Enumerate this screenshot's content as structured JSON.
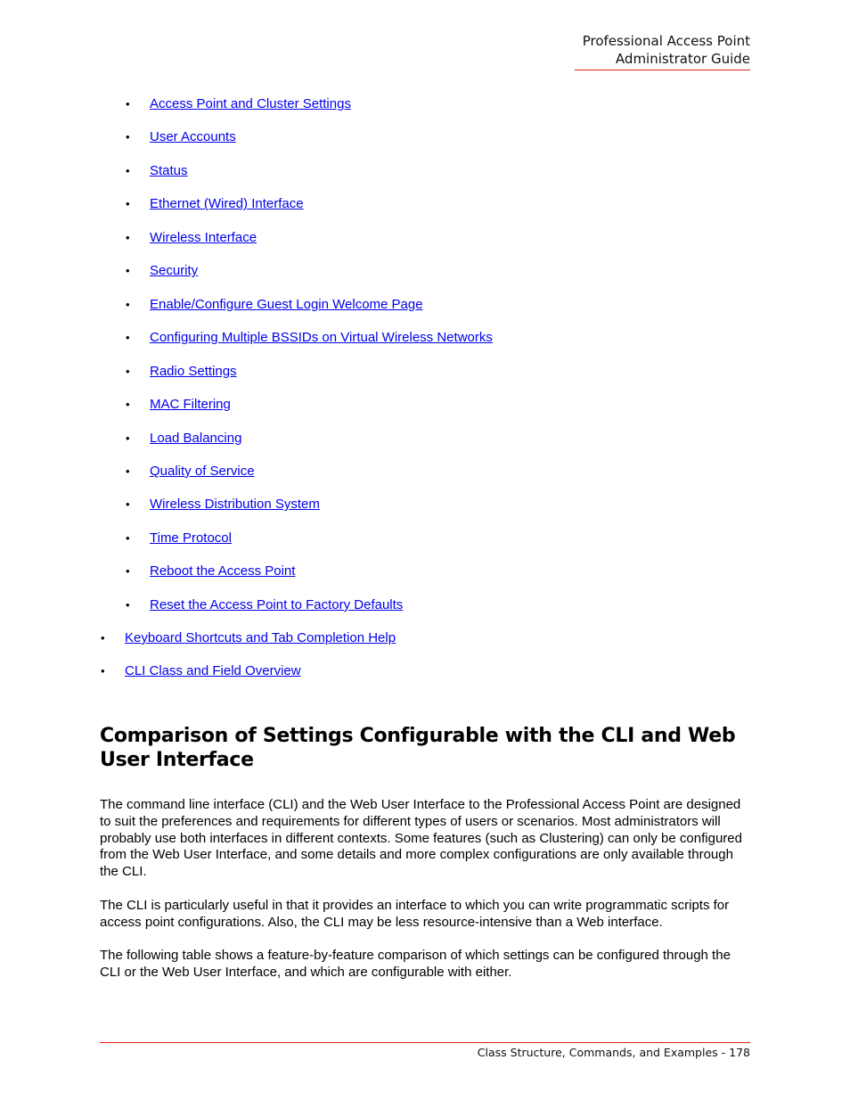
{
  "header": {
    "line1": "Professional Access Point",
    "line2": "Administrator Guide"
  },
  "sublist": [
    {
      "label": "Access Point and Cluster Settings"
    },
    {
      "label": "User Accounts"
    },
    {
      "label": "Status"
    },
    {
      "label": "Ethernet (Wired) Interface"
    },
    {
      "label": "Wireless Interface"
    },
    {
      "label": "Security"
    },
    {
      "label": "Enable/Configure Guest Login Welcome Page"
    },
    {
      "label": "Configuring Multiple BSSIDs on Virtual Wireless Networks"
    },
    {
      "label": "Radio Settings"
    },
    {
      "label": "MAC Filtering"
    },
    {
      "label": "Load Balancing"
    },
    {
      "label": "Quality of Service"
    },
    {
      "label": "Wireless Distribution System"
    },
    {
      "label": "Time Protocol"
    },
    {
      "label": "Reboot the Access Point"
    },
    {
      "label": "Reset the Access Point to Factory Defaults"
    }
  ],
  "toplist": [
    {
      "label": "Keyboard Shortcuts and Tab Completion Help"
    },
    {
      "label": "CLI Class and Field Overview"
    }
  ],
  "bullet_char": "•",
  "section": {
    "heading": "Comparison of Settings Configurable with the CLI and Web User Interface",
    "paragraphs": [
      "The command line interface (CLI) and the Web User Interface to the Professional Access Point are designed to suit the preferences and requirements for different types of users or scenarios. Most administrators will probably use both interfaces in different contexts. Some features (such as Clustering) can only be configured from the Web User Interface, and some details and more complex configurations are only available through the CLI.",
      "The CLI is particularly useful in that it provides an interface to which you can write programmatic scripts for access point configurations. Also, the CLI may be less resource-intensive than a Web interface.",
      "The following table shows a feature-by-feature comparison of which settings can be configured through the CLI or the Web User Interface, and which are configurable with either."
    ]
  },
  "footer": {
    "text": "Class Structure, Commands, and Examples - 178"
  },
  "colors": {
    "link": "#0000ee",
    "rule": "#e01b1b"
  }
}
